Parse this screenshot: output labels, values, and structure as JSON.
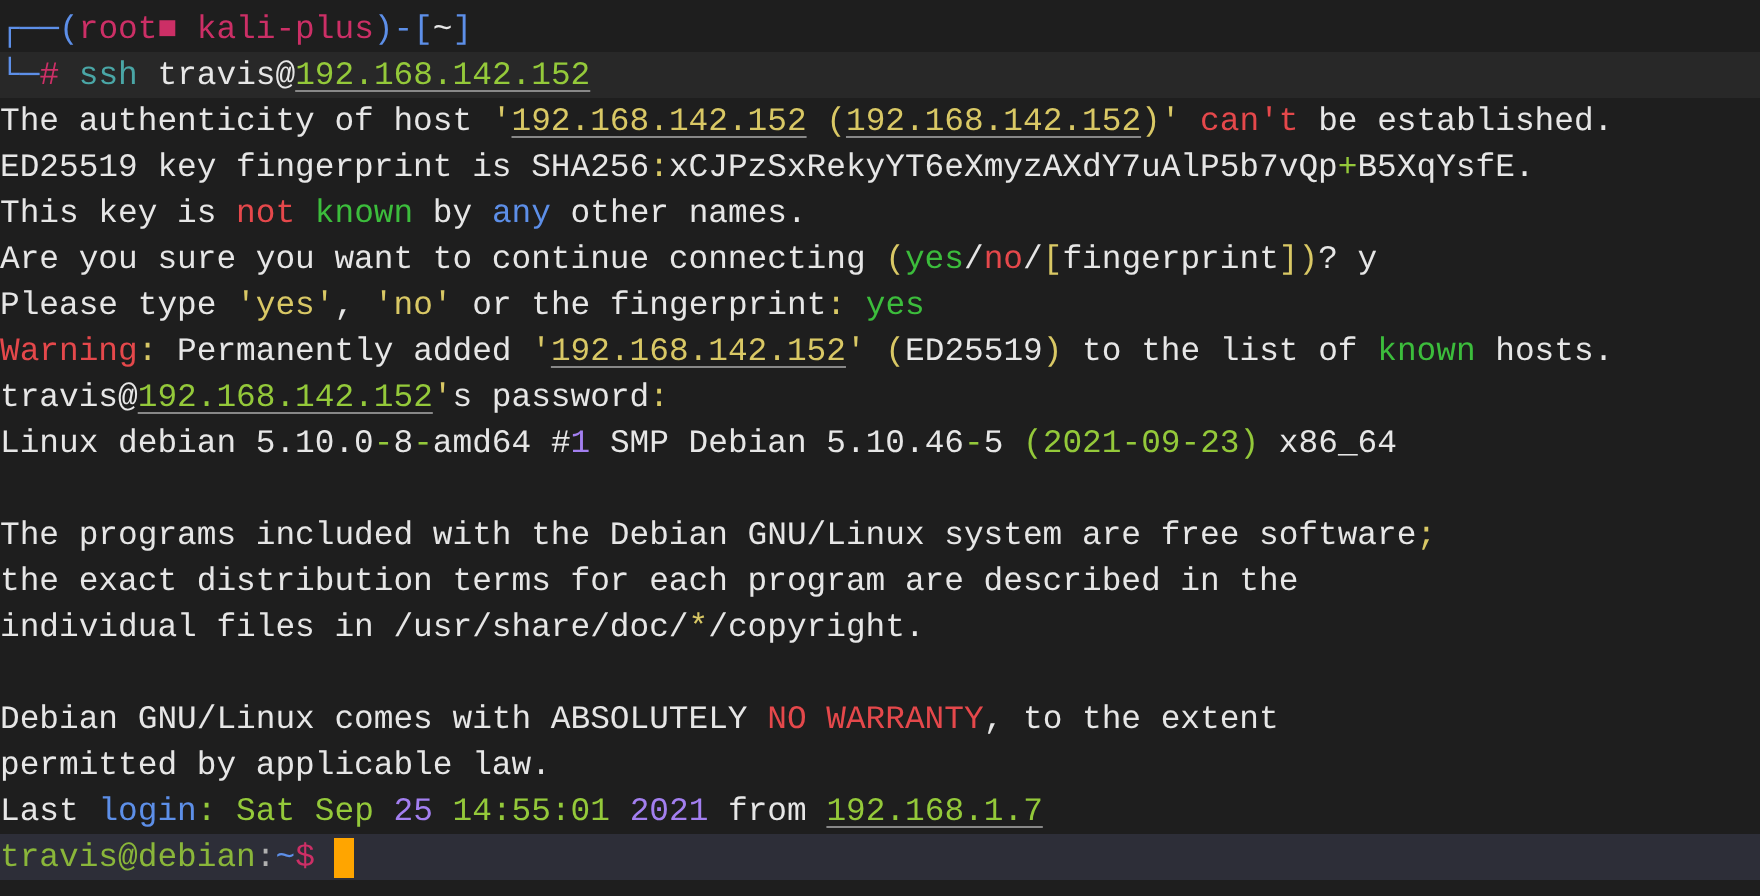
{
  "terminal": {
    "lines": [
      {
        "kind": "prompt_header",
        "segments": [
          {
            "text": "┌──(",
            "color": "#5d8fe8"
          },
          {
            "text": "root■ kali-plus",
            "color": "#cc2f66"
          },
          {
            "text": ")-[",
            "color": "#5d8fe8"
          },
          {
            "text": "~",
            "color": "#e6e6e6"
          },
          {
            "text": "]",
            "color": "#5d8fe8"
          }
        ]
      },
      {
        "kind": "command",
        "segments": [
          {
            "text": "└─",
            "color": "#5d8fe8"
          },
          {
            "text": "#",
            "color": "#cc2f66"
          },
          {
            "text": " ssh",
            "color": "#4aa6a6"
          },
          {
            "text": " travis@",
            "color": "#e6e6e6"
          },
          {
            "text": "192.168.142.152",
            "color": "#94c93a",
            "underline": true
          }
        ]
      },
      {
        "kind": "output",
        "segments": [
          {
            "text": "The authenticity of host ",
            "color": "#e6e6e6"
          },
          {
            "text": "'",
            "color": "#d9c865"
          },
          {
            "text": "192.168.142.152",
            "color": "#d9c865",
            "underline": true
          },
          {
            "text": " (",
            "color": "#d9c865"
          },
          {
            "text": "192.168.142.152",
            "color": "#d9c865",
            "underline": true
          },
          {
            "text": ")'",
            "color": "#d9c865"
          },
          {
            "text": " can't",
            "color": "#e5484b"
          },
          {
            "text": " be established.",
            "color": "#e6e6e6"
          }
        ]
      },
      {
        "kind": "output",
        "segments": [
          {
            "text": "ED25519 key fingerprint is SHA256",
            "color": "#e6e6e6"
          },
          {
            "text": ":",
            "color": "#d9c865"
          },
          {
            "text": "xCJPzSxRekyYT6eXmyzAXdY7uAlP5b7vQp",
            "color": "#e6e6e6"
          },
          {
            "text": "+",
            "color": "#94c93a"
          },
          {
            "text": "B5XqYsfE.",
            "color": "#e6e6e6"
          }
        ]
      },
      {
        "kind": "output",
        "segments": [
          {
            "text": "This key is ",
            "color": "#e6e6e6"
          },
          {
            "text": "not",
            "color": "#e5484b"
          },
          {
            "text": " known",
            "color": "#3cbd3c"
          },
          {
            "text": " by ",
            "color": "#e6e6e6"
          },
          {
            "text": "any",
            "color": "#5d8fe8"
          },
          {
            "text": " other names.",
            "color": "#e6e6e6"
          }
        ]
      },
      {
        "kind": "output",
        "segments": [
          {
            "text": "Are you sure you want to continue connecting ",
            "color": "#e6e6e6"
          },
          {
            "text": "(",
            "color": "#d9c865"
          },
          {
            "text": "yes",
            "color": "#3cbd3c"
          },
          {
            "text": "/",
            "color": "#e6e6e6"
          },
          {
            "text": "no",
            "color": "#e5484b"
          },
          {
            "text": "/",
            "color": "#e6e6e6"
          },
          {
            "text": "[",
            "color": "#d9c865"
          },
          {
            "text": "fingerprint",
            "color": "#e6e6e6"
          },
          {
            "text": "])",
            "color": "#d9c865"
          },
          {
            "text": "? y",
            "color": "#e6e6e6"
          }
        ]
      },
      {
        "kind": "output",
        "segments": [
          {
            "text": "Please type ",
            "color": "#e6e6e6"
          },
          {
            "text": "'yes'",
            "color": "#d9c865"
          },
          {
            "text": ", ",
            "color": "#e6e6e6"
          },
          {
            "text": "'no'",
            "color": "#d9c865"
          },
          {
            "text": " or the fingerprint",
            "color": "#e6e6e6"
          },
          {
            "text": ":",
            "color": "#d9c865"
          },
          {
            "text": " yes",
            "color": "#3cbd3c"
          }
        ]
      },
      {
        "kind": "output",
        "segments": [
          {
            "text": "Warning",
            "color": "#e5484b"
          },
          {
            "text": ":",
            "color": "#d9c865"
          },
          {
            "text": " Permanently added ",
            "color": "#e6e6e6"
          },
          {
            "text": "'",
            "color": "#d9c865"
          },
          {
            "text": "192.168.142.152",
            "color": "#d9c865",
            "underline": true
          },
          {
            "text": "'",
            "color": "#d9c865"
          },
          {
            "text": " (",
            "color": "#d9c865"
          },
          {
            "text": "ED25519",
            "color": "#e6e6e6"
          },
          {
            "text": ")",
            "color": "#d9c865"
          },
          {
            "text": " to the list of ",
            "color": "#e6e6e6"
          },
          {
            "text": "known",
            "color": "#3cbd3c"
          },
          {
            "text": " hosts.",
            "color": "#e6e6e6"
          }
        ]
      },
      {
        "kind": "output",
        "segments": [
          {
            "text": "travis@",
            "color": "#e6e6e6"
          },
          {
            "text": "192.168.142.152",
            "color": "#94c93a",
            "underline": true
          },
          {
            "text": "'",
            "color": "#d9c865"
          },
          {
            "text": "s password",
            "color": "#e6e6e6"
          },
          {
            "text": ":",
            "color": "#d9c865"
          }
        ]
      },
      {
        "kind": "output",
        "segments": [
          {
            "text": "Linux debian 5.10.0",
            "color": "#e6e6e6"
          },
          {
            "text": "-",
            "color": "#94c93a"
          },
          {
            "text": "8",
            "color": "#e6e6e6"
          },
          {
            "text": "-",
            "color": "#94c93a"
          },
          {
            "text": "amd64 #",
            "color": "#e6e6e6"
          },
          {
            "text": "1",
            "color": "#a37ff0"
          },
          {
            "text": " SMP Debian 5.10.46",
            "color": "#e6e6e6"
          },
          {
            "text": "-",
            "color": "#94c93a"
          },
          {
            "text": "5 ",
            "color": "#e6e6e6"
          },
          {
            "text": "(2021-09-23)",
            "color": "#94c93a"
          },
          {
            "text": " x86_64",
            "color": "#e6e6e6"
          }
        ]
      },
      {
        "kind": "blank"
      },
      {
        "kind": "output",
        "segments": [
          {
            "text": "The programs included with the Debian GNU/Linux system are free software",
            "color": "#e6e6e6"
          },
          {
            "text": ";",
            "color": "#d9c865"
          }
        ]
      },
      {
        "kind": "output",
        "segments": [
          {
            "text": "the exact distribution terms for each program are described in the",
            "color": "#e6e6e6"
          }
        ]
      },
      {
        "kind": "output",
        "segments": [
          {
            "text": "individual files in /usr/share/doc/",
            "color": "#e6e6e6"
          },
          {
            "text": "*",
            "color": "#d9c865"
          },
          {
            "text": "/copyright.",
            "color": "#e6e6e6"
          }
        ]
      },
      {
        "kind": "blank"
      },
      {
        "kind": "output",
        "segments": [
          {
            "text": "Debian GNU/Linux comes with ABSOLUTELY ",
            "color": "#e6e6e6"
          },
          {
            "text": "NO WARRANTY",
            "color": "#e5484b"
          },
          {
            "text": ", to the extent",
            "color": "#e6e6e6"
          }
        ]
      },
      {
        "kind": "output",
        "segments": [
          {
            "text": "permitted by applicable law.",
            "color": "#e6e6e6"
          }
        ]
      },
      {
        "kind": "output",
        "segments": [
          {
            "text": "Last ",
            "color": "#e6e6e6"
          },
          {
            "text": "login",
            "color": "#5d8fe8"
          },
          {
            "text": ":",
            "color": "#94c93a"
          },
          {
            "text": " Sat Sep ",
            "color": "#94c93a"
          },
          {
            "text": "25",
            "color": "#a37ff0"
          },
          {
            "text": " 14:55:01 ",
            "color": "#94c93a"
          },
          {
            "text": "2021",
            "color": "#a37ff0"
          },
          {
            "text": " from ",
            "color": "#e6e6e6"
          },
          {
            "text": "192.168.1.7",
            "color": "#94c93a",
            "underline": true
          }
        ]
      },
      {
        "kind": "shell_prompt",
        "segments": [
          {
            "text": "travis@debian",
            "color": "#8ab63a"
          },
          {
            "text": ":",
            "color": "#b0b0b0"
          },
          {
            "text": "~",
            "color": "#5d8fe8"
          },
          {
            "text": "$",
            "color": "#cc2f66"
          }
        ]
      }
    ]
  }
}
